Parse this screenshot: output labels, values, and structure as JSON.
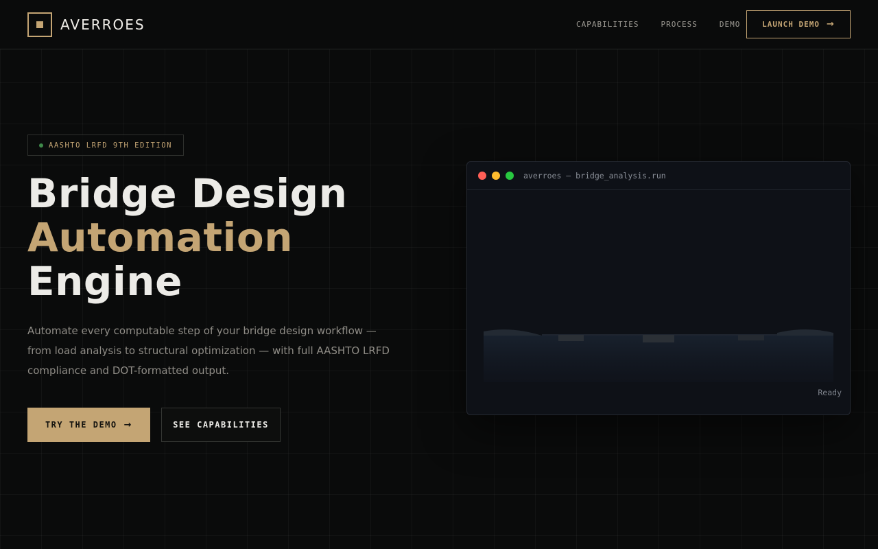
{
  "nav": {
    "brand": "AVERROES",
    "links": [
      "CAPABILITIES",
      "PROCESS",
      "DEMO"
    ],
    "cta_label": "LAUNCH DEMO"
  },
  "hero": {
    "badge": "AASHTO LRFD 9TH EDITION",
    "headline_line1": "Bridge Design",
    "headline_line2": "Automation",
    "headline_line3": "Engine",
    "subtitle": "Automate every computable step of your bridge design workflow — from load analysis to structural optimization — with full AASHTO LRFD compliance and DOT-formatted output.",
    "primary_button": "TRY THE DEMO",
    "secondary_button": "SEE CAPABILITIES"
  },
  "terminal": {
    "title": "averroes — bridge_analysis.run",
    "status": "Ready"
  },
  "icons": {
    "arrow": "arrow-right-icon",
    "logo": "square-logo-icon"
  },
  "colors": {
    "accent": "#c4a574",
    "background": "#0a0b0b",
    "dot_red": "#ff5f57",
    "dot_yellow": "#febc2e",
    "dot_green": "#28c840",
    "badge_dot": "#3f8a4a"
  }
}
